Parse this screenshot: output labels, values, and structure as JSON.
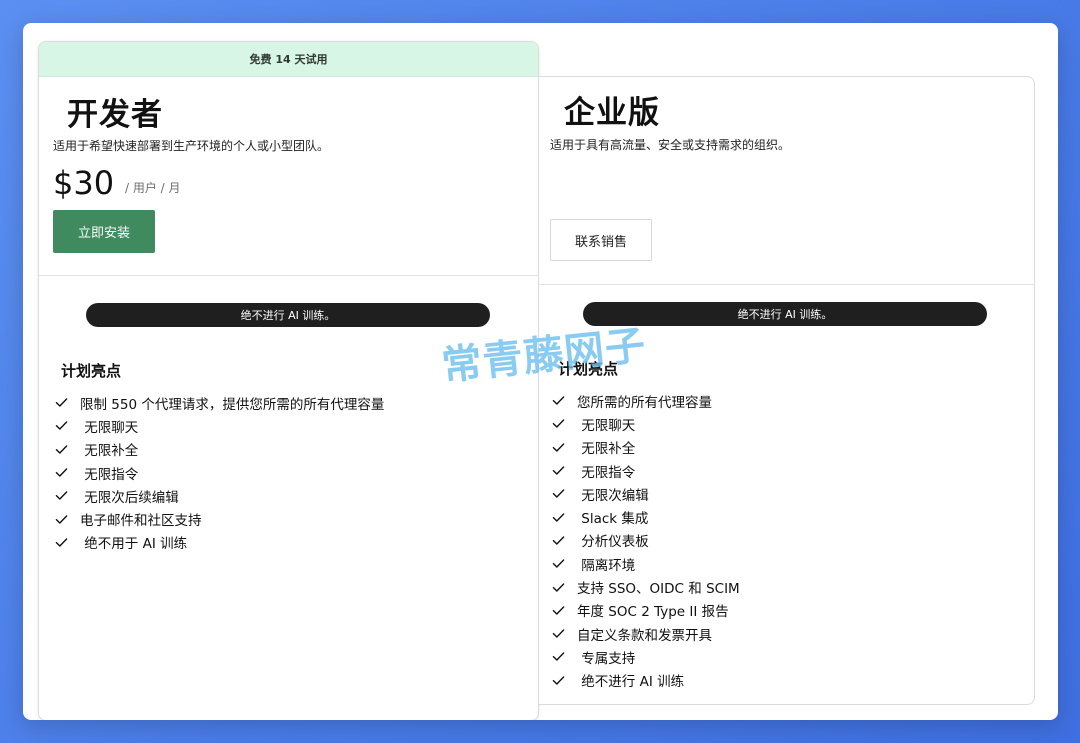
{
  "developer": {
    "trial_badge": "免费 14 天试用",
    "name": "开发者",
    "description": "适用于希望快速部署到生产环境的个人或小型团队。",
    "price": "$30",
    "price_unit": "/ 用户 / 月",
    "cta": "立即安装",
    "ai_notice": "绝不进行 AI 训练。",
    "highlights_title": "计划亮点",
    "features": [
      "限制 550 个代理请求，提供您所需的所有代理容量",
      " 无限聊天",
      " 无限补全",
      " 无限指令",
      " 无限次后续编辑",
      "电子邮件和社区支持",
      " 绝不用于 AI 训练"
    ]
  },
  "enterprise": {
    "name": "企业版",
    "description": "适用于具有高流量、安全或支持需求的组织。",
    "cta": "联系销售",
    "ai_notice": "绝不进行 AI 训练。",
    "highlights_title": "计划亮点",
    "features": [
      "您所需的所有代理容量",
      " 无限聊天",
      " 无限补全",
      " 无限指令",
      " 无限次编辑",
      " Slack 集成",
      " 分析仪表板",
      " 隔离环境",
      "支持 SSO、OIDC 和 SCIM",
      "年度 SOC 2 Type II 报告",
      "自定义条款和发票开具",
      " 专属支持",
      " 绝不进行 AI 训练"
    ]
  },
  "watermark": "常青藤网子",
  "colors": {
    "background": "#4a7de8",
    "primary_button": "#3f8a5f",
    "trial_banner": "#d8f6e6",
    "pill": "#1f1f1f",
    "watermark": "#6ec0ee"
  },
  "icons": {
    "feature_bullet": "check-icon"
  }
}
